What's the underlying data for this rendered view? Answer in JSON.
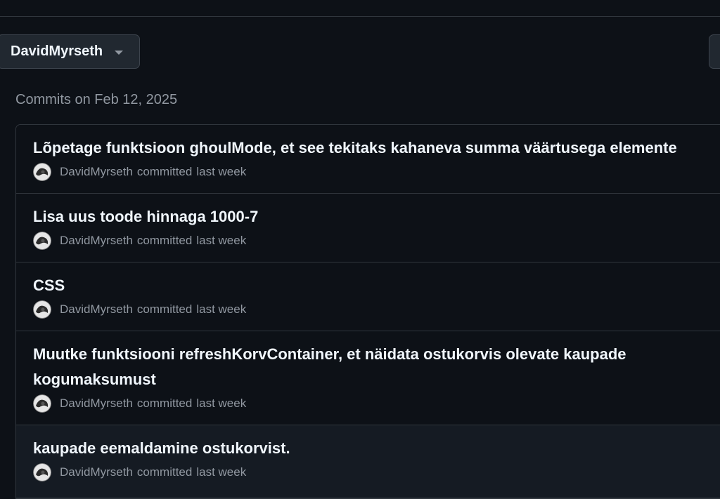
{
  "filters": {
    "author_label": "DavidMyrseth"
  },
  "day": {
    "header": "Commits on Feb 12, 2025"
  },
  "commits": [
    {
      "title": "Lõpetage funktsioon ghoulMode, et see tekitaks kahaneva summa väärtusega elemente",
      "author": "DavidMyrseth",
      "verb": "committed",
      "time": "last week"
    },
    {
      "title": "Lisa uus toode hinnaga 1000-7",
      "author": "DavidMyrseth",
      "verb": "committed",
      "time": "last week"
    },
    {
      "title": "CSS",
      "author": "DavidMyrseth",
      "verb": "committed",
      "time": "last week"
    },
    {
      "title": "Muutke funktsiooni refreshKorvContainer, et näidata ostukorvis olevate kaupade kogumaksumust",
      "author": "DavidMyrseth",
      "verb": "committed",
      "time": "last week"
    },
    {
      "title": "kaupade eemaldamine ostukorvist.",
      "author": "DavidMyrseth",
      "verb": "committed",
      "time": "last week"
    }
  ],
  "colors": {
    "background": "#0d1117",
    "border": "#30363d",
    "muted_text": "#9198a1",
    "text": "#f0f6fc"
  },
  "icons": {
    "avatar": "avatar-icon",
    "dropdown": "chevron-down-icon"
  }
}
